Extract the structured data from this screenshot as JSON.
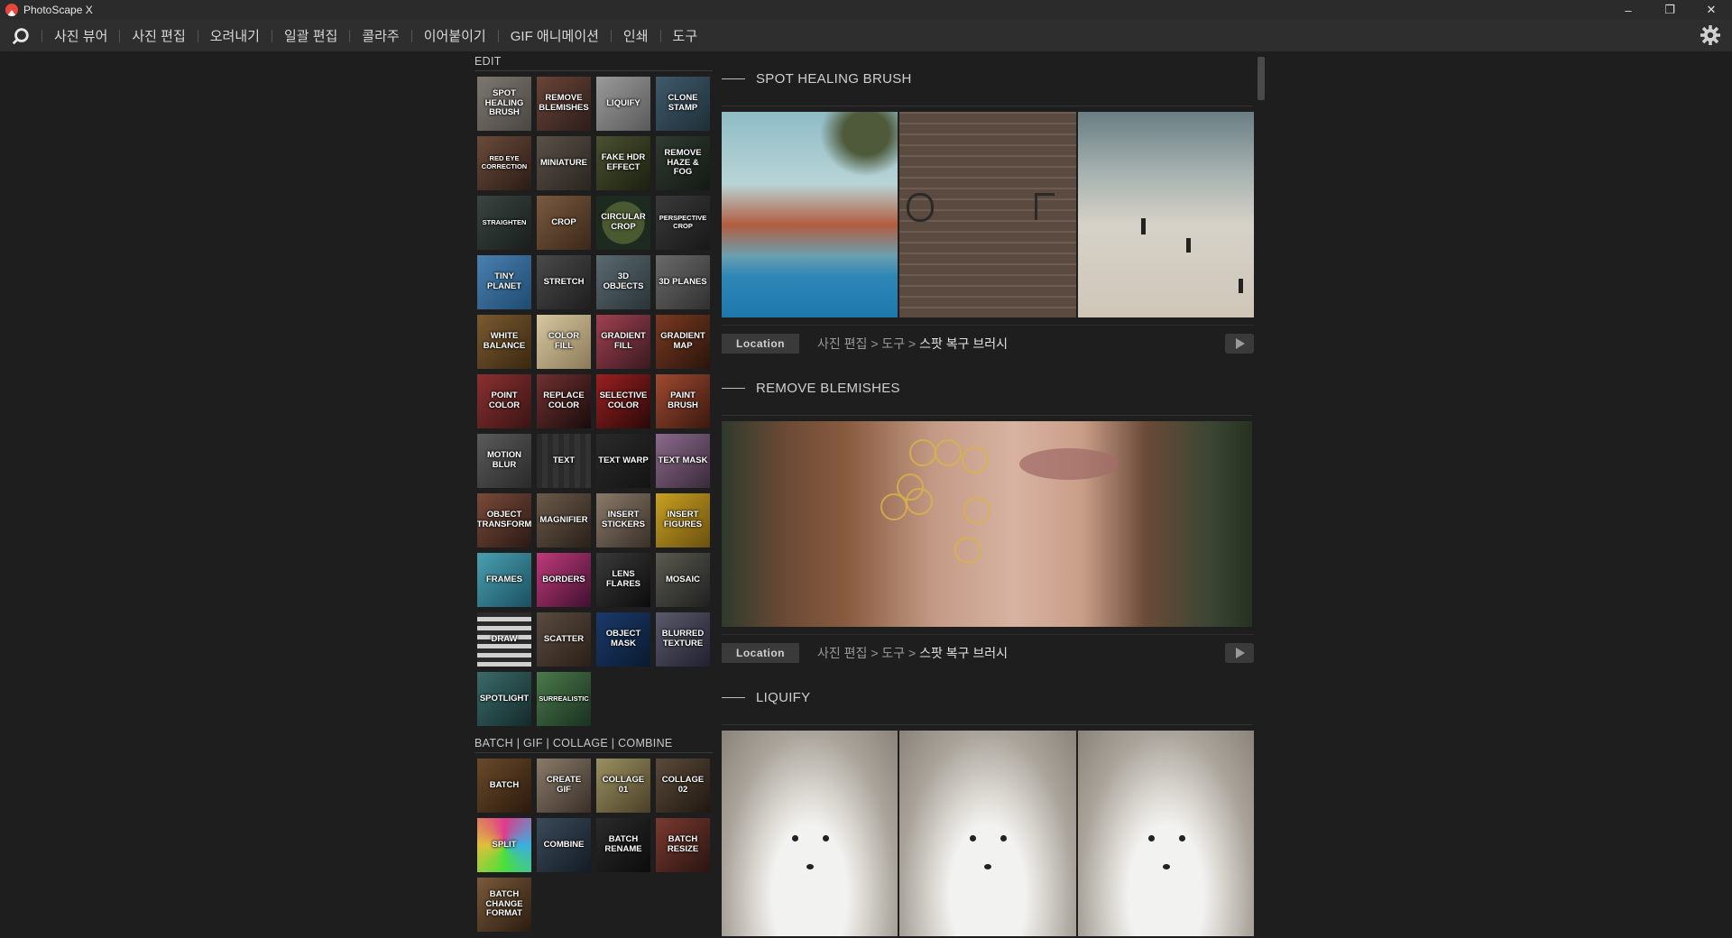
{
  "window": {
    "title": "PhotoScape X",
    "minimize": "–",
    "restore": "❐",
    "close": "✕"
  },
  "menu": [
    {
      "label": "사진 뷰어"
    },
    {
      "label": "사진 편집"
    },
    {
      "label": "오려내기"
    },
    {
      "label": "일괄 편집"
    },
    {
      "label": "콜라주"
    },
    {
      "label": "이어붙이기"
    },
    {
      "label": "GIF 애니메이션"
    },
    {
      "label": "인쇄"
    },
    {
      "label": "도구"
    }
  ],
  "sidebar": {
    "edit_heading": "EDIT",
    "edit_tools": [
      {
        "label": "SPOT HEALING BRUSH"
      },
      {
        "label": "REMOVE BLEMISHES"
      },
      {
        "label": "LIQUIFY"
      },
      {
        "label": "CLONE STAMP"
      },
      {
        "label": "RED EYE CORRECTION"
      },
      {
        "label": "MINIATURE"
      },
      {
        "label": "FAKE HDR EFFECT"
      },
      {
        "label": "REMOVE HAZE & FOG"
      },
      {
        "label": "STRAIGHTEN"
      },
      {
        "label": "CROP"
      },
      {
        "label": "CIRCULAR CROP"
      },
      {
        "label": "PERSPECTIVE CROP"
      },
      {
        "label": "TINY PLANET"
      },
      {
        "label": "STRETCH"
      },
      {
        "label": "3D OBJECTS"
      },
      {
        "label": "3D PLANES"
      },
      {
        "label": "WHITE BALANCE"
      },
      {
        "label": "COLOR FILL"
      },
      {
        "label": "GRADIENT FILL"
      },
      {
        "label": "GRADIENT MAP"
      },
      {
        "label": "POINT COLOR"
      },
      {
        "label": "REPLACE COLOR"
      },
      {
        "label": "SELECTIVE COLOR"
      },
      {
        "label": "PAINT BRUSH"
      },
      {
        "label": "MOTION BLUR"
      },
      {
        "label": "TEXT"
      },
      {
        "label": "TEXT WARP"
      },
      {
        "label": "TEXT MASK"
      },
      {
        "label": "OBJECT TRANSFORM"
      },
      {
        "label": "MAGNIFIER"
      },
      {
        "label": "INSERT STICKERS"
      },
      {
        "label": "INSERT FIGURES"
      },
      {
        "label": "FRAMES"
      },
      {
        "label": "BORDERS"
      },
      {
        "label": "LENS FLARES"
      },
      {
        "label": "MOSAIC"
      },
      {
        "label": "DRAW"
      },
      {
        "label": "SCATTER"
      },
      {
        "label": "OBJECT MASK"
      },
      {
        "label": "BLURRED TEXTURE"
      },
      {
        "label": "SPOTLIGHT"
      },
      {
        "label": "SURREALISTIC"
      }
    ],
    "batch_heading": "BATCH | GIF | COLLAGE | COMBINE",
    "batch_tools": [
      {
        "label": "BATCH"
      },
      {
        "label": "CREATE GIF"
      },
      {
        "label": "COLLAGE 01"
      },
      {
        "label": "COLLAGE 02"
      },
      {
        "label": "SPLIT"
      },
      {
        "label": "COMBINE"
      },
      {
        "label": "BATCH RENAME"
      },
      {
        "label": "BATCH RESIZE"
      },
      {
        "label": "BATCH CHANGE FORMAT"
      }
    ]
  },
  "sections": [
    {
      "title": "SPOT HEALING BRUSH",
      "location_label": "Location",
      "path_1": "사진 편집",
      "path_sep": ">",
      "path_2": "도구",
      "path_3": "스팟 복구 브러시"
    },
    {
      "title": "REMOVE BLEMISHES",
      "location_label": "Location",
      "path_1": "사진 편집",
      "path_sep": ">",
      "path_2": "도구",
      "path_3": "스팟 복구 브러시"
    },
    {
      "title": "LIQUIFY"
    }
  ]
}
